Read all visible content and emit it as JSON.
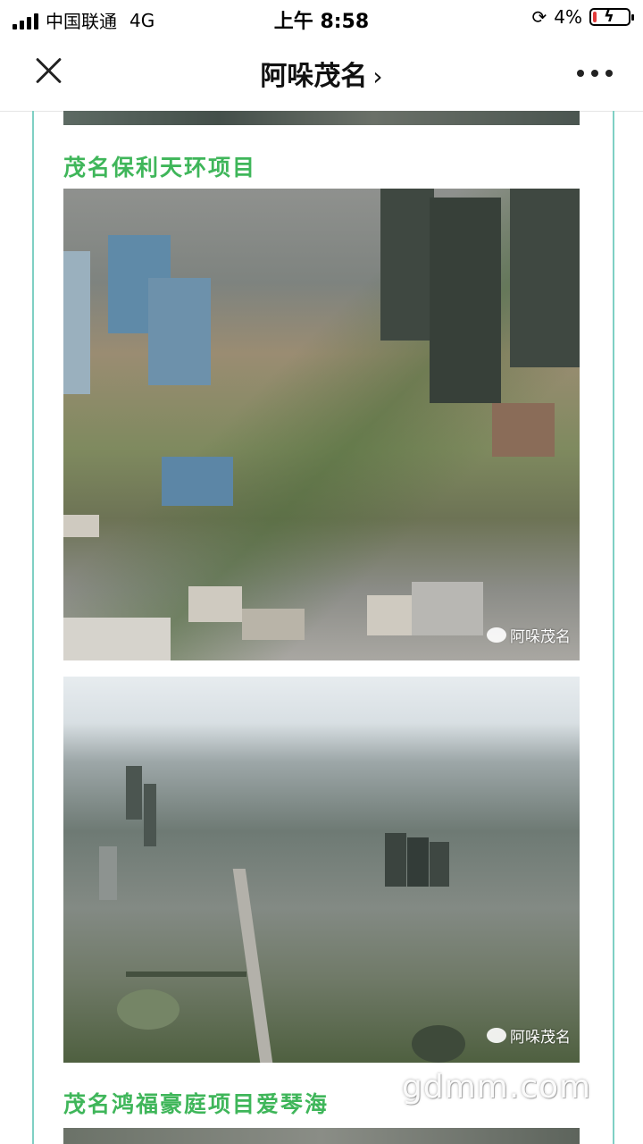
{
  "status_bar": {
    "carrier": "中国联通",
    "network": "4G",
    "time": "上午 8:58",
    "battery_percent": "4%",
    "battery_level": 0.04
  },
  "nav": {
    "title": "阿哚茂名",
    "chevron": "›"
  },
  "article": {
    "section1_heading": "茂名保利天环项目",
    "section2_heading": "茂名鸿福豪庭项目爱琴海",
    "photo1_watermark": "阿哚茂名",
    "photo2_watermark": "阿哚茂名"
  },
  "site_watermark": "gdmm.com",
  "icons": [
    "signal-icon",
    "orientation-lock-icon",
    "battery-icon",
    "close-icon",
    "chevron-right-icon",
    "more-icon",
    "wechat-icon"
  ],
  "colors": {
    "heading_green": "#3fb65a",
    "frame_teal": "#7fd0c4",
    "battery_low": "#e23b3b"
  }
}
